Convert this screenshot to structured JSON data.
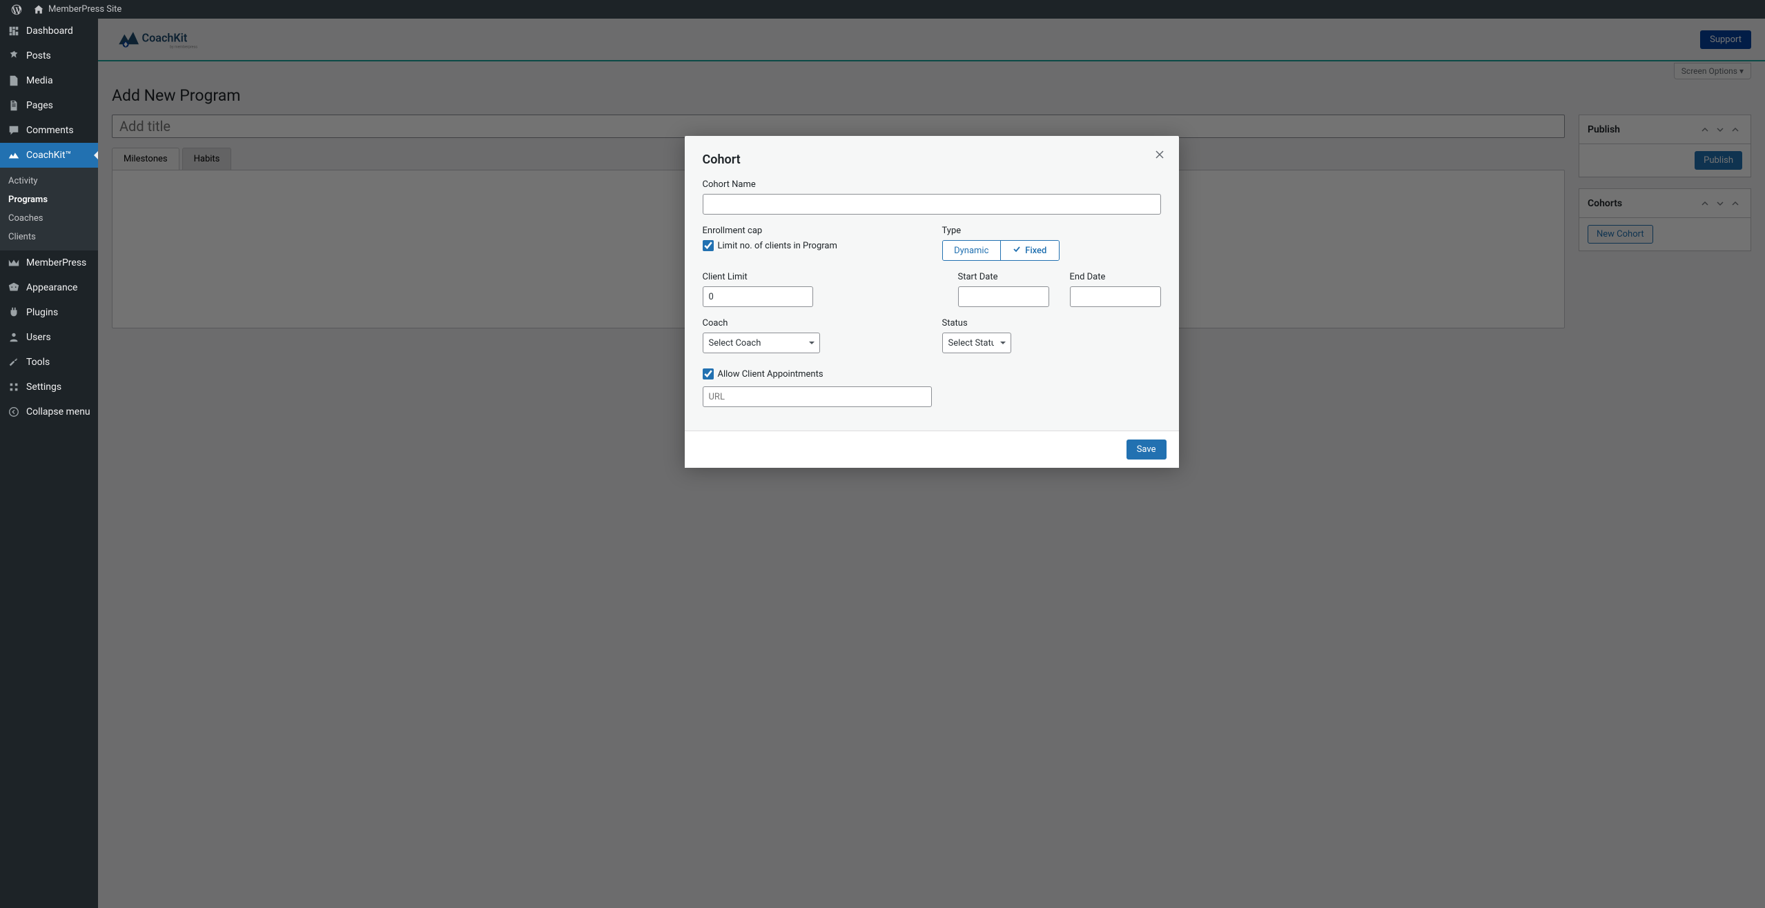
{
  "admin_bar": {
    "site_name": "MemberPress Site"
  },
  "sidebar": {
    "items": [
      {
        "label": "Dashboard"
      },
      {
        "label": "Posts"
      },
      {
        "label": "Media"
      },
      {
        "label": "Pages"
      },
      {
        "label": "Comments"
      },
      {
        "label": "CoachKit™"
      },
      {
        "label": "MemberPress"
      },
      {
        "label": "Appearance"
      },
      {
        "label": "Plugins"
      },
      {
        "label": "Users"
      },
      {
        "label": "Tools"
      },
      {
        "label": "Settings"
      }
    ],
    "submenu": {
      "activity": "Activity",
      "programs": "Programs",
      "coaches": "Coaches",
      "clients": "Clients"
    },
    "collapse_label": "Collapse menu"
  },
  "header": {
    "logo_text": "CoachKit",
    "logo_sub": "by memberpress",
    "support_btn": "Support"
  },
  "screen_options_label": "Screen Options ▾",
  "page": {
    "title": "Add New Program",
    "title_placeholder": "Add title",
    "tabs": {
      "milestones": "Milestones",
      "habits": "Habits"
    }
  },
  "publish_box": {
    "title": "Publish",
    "button": "Publish"
  },
  "cohorts_box": {
    "title": "Cohorts",
    "new_button": "New Cohort"
  },
  "modal": {
    "title": "Cohort",
    "cohort_name_label": "Cohort Name",
    "cohort_name_value": "",
    "enrollment_cap_label": "Enrollment cap",
    "limit_checkbox_label": "Limit no. of clients in Program",
    "limit_checked": true,
    "type_label": "Type",
    "type_dynamic": "Dynamic",
    "type_fixed": "Fixed",
    "type_selected": "Fixed",
    "client_limit_label": "Client Limit",
    "client_limit_value": "0",
    "start_date_label": "Start Date",
    "start_date_value": "",
    "end_date_label": "End Date",
    "end_date_value": "",
    "coach_label": "Coach",
    "coach_select_placeholder": "Select Coach",
    "status_label": "Status",
    "status_select_placeholder": "Select Status",
    "allow_appt_label": "Allow Client Appointments",
    "allow_appt_checked": true,
    "url_placeholder": "URL",
    "url_value": "",
    "save_btn": "Save"
  }
}
